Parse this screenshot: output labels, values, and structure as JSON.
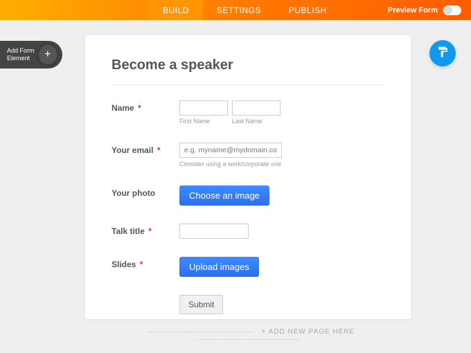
{
  "topbar": {
    "tabs": [
      "BUILD",
      "SETTINGS",
      "PUBLISH"
    ],
    "active_index": 0,
    "preview_label": "Preview Form"
  },
  "add_element": {
    "label": "Add Form Element",
    "plus": "+"
  },
  "form": {
    "title": "Become a speaker",
    "name": {
      "label": "Name",
      "first_sub": "First Name",
      "last_sub": "Last Name"
    },
    "email": {
      "label": "Your email",
      "placeholder": "e.g. myname@mydomain.com",
      "hint": "Consider using a work/corporate one"
    },
    "photo": {
      "label": "Your photo",
      "button": "Choose an image"
    },
    "talk": {
      "label": "Talk title"
    },
    "slides": {
      "label": "Slides",
      "button": "Upload images"
    },
    "submit": "Submit"
  },
  "add_page": "+ ADD NEW PAGE HERE",
  "required_mark": "*"
}
